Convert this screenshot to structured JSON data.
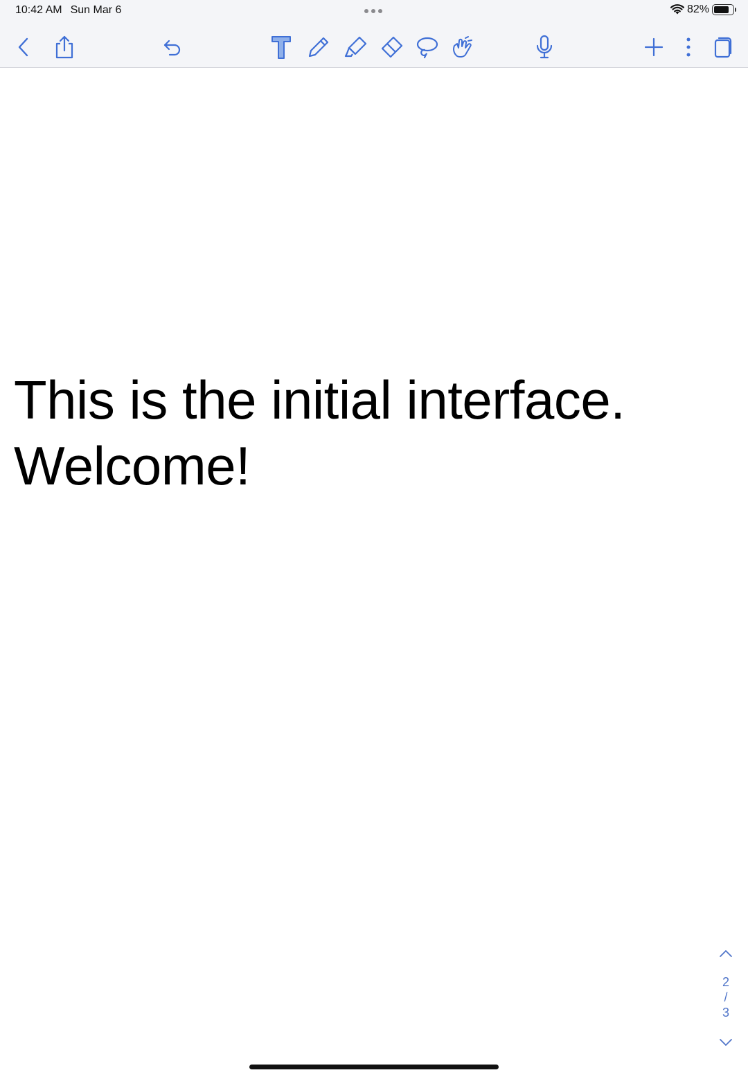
{
  "status_bar": {
    "time": "10:42 AM",
    "date": "Sun Mar 6",
    "battery_percent": "82%",
    "battery_level": 0.82
  },
  "toolbar": {
    "icons": [
      "chevron-left-icon",
      "share-icon",
      "undo-icon",
      "text-tool-icon",
      "pen-icon",
      "highlighter-icon",
      "eraser-icon",
      "lasso-icon",
      "hand-pointer-icon",
      "microphone-icon",
      "plus-icon",
      "more-vertical-icon",
      "pages-icon"
    ],
    "accent_color": "#3f6fd6"
  },
  "note": {
    "line1": "This is the initial interface.",
    "line2": "Welcome!"
  },
  "pager": {
    "current_page": "2",
    "separator": "/",
    "total_pages": "3"
  }
}
